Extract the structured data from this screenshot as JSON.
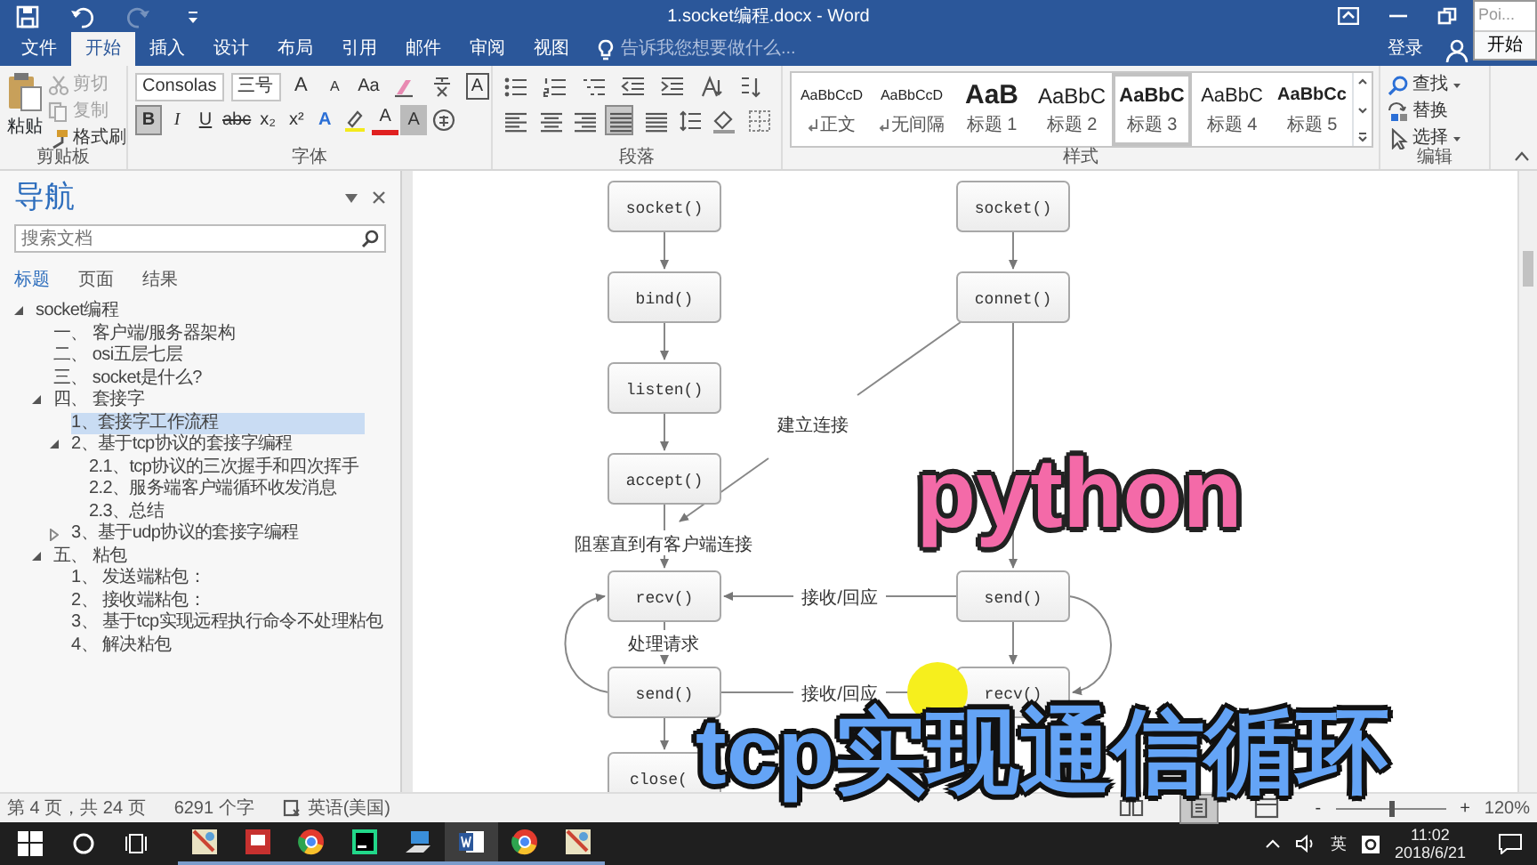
{
  "window": {
    "title": "1.socket编程.docx - Word"
  },
  "quick_access": [
    {
      "kind": "save",
      "disabled": false
    },
    {
      "kind": "undo",
      "disabled": false
    },
    {
      "kind": "redo",
      "disabled": true
    },
    {
      "kind": "customize",
      "disabled": false
    }
  ],
  "popup": {
    "title": "Poi...",
    "button": "开始"
  },
  "tabs": [
    {
      "label": "文件",
      "selected": false
    },
    {
      "label": "开始",
      "selected": true
    },
    {
      "label": "插入",
      "selected": false
    },
    {
      "label": "设计",
      "selected": false
    },
    {
      "label": "布局",
      "selected": false
    },
    {
      "label": "引用",
      "selected": false
    },
    {
      "label": "邮件",
      "selected": false
    },
    {
      "label": "审阅",
      "selected": false
    },
    {
      "label": "视图",
      "selected": false
    }
  ],
  "tell_me": {
    "placeholder": "告诉我您想要做什么..."
  },
  "sign_in": "登录",
  "clipboard": {
    "label": "剪贴板",
    "paste": "粘贴",
    "items": [
      {
        "kind": "cut",
        "label": "剪切",
        "disabled": true
      },
      {
        "kind": "copy",
        "label": "复制",
        "disabled": true
      },
      {
        "kind": "painter",
        "label": "格式刷",
        "disabled": false
      }
    ]
  },
  "font": {
    "label": "字体",
    "font_name": "Consolas",
    "font_size": "三号",
    "row1": [
      {
        "kind": "grow",
        "text": "A",
        "selected": false
      },
      {
        "kind": "shrink",
        "text": "A",
        "selected": false
      },
      {
        "kind": "case",
        "text": "Aa",
        "selected": false
      },
      {
        "kind": "clear",
        "selected": false
      },
      {
        "kind": "phonetic",
        "selected": false
      },
      {
        "kind": "border",
        "text": "A",
        "selected": false
      }
    ],
    "row2": [
      {
        "kind": "bold",
        "text": "B",
        "selected": true
      },
      {
        "kind": "italic",
        "text": "I",
        "selected": false
      },
      {
        "kind": "underline",
        "text": "U",
        "selected": false
      },
      {
        "kind": "strike",
        "text": "abc",
        "selected": false
      },
      {
        "kind": "sub",
        "text": "x₂",
        "selected": false
      },
      {
        "kind": "sup",
        "text": "x²",
        "selected": false
      },
      {
        "kind": "effect",
        "text": "A",
        "selected": false
      },
      {
        "kind": "highlight",
        "selected": false
      },
      {
        "kind": "color",
        "text": "A",
        "selected": false
      },
      {
        "kind": "shading",
        "text": "A",
        "selected": false
      },
      {
        "kind": "enclose",
        "selected": false
      }
    ]
  },
  "paragraph": {
    "label": "段落",
    "row1": [
      {
        "kind": "bullets",
        "selected": false
      },
      {
        "kind": "numbering",
        "selected": false
      },
      {
        "kind": "multilevel",
        "selected": false
      },
      {
        "kind": "outdent",
        "selected": false
      },
      {
        "kind": "indent",
        "selected": false
      },
      {
        "kind": "layout",
        "selected": false
      },
      {
        "kind": "sort",
        "selected": false
      }
    ],
    "row2": [
      {
        "kind": "left",
        "selected": false
      },
      {
        "kind": "center",
        "selected": false
      },
      {
        "kind": "right",
        "selected": false
      },
      {
        "kind": "justify",
        "selected": true
      },
      {
        "kind": "distribute",
        "selected": false
      },
      {
        "kind": "spacing",
        "selected": false
      },
      {
        "kind": "shading",
        "selected": false
      },
      {
        "kind": "borders",
        "selected": false
      }
    ]
  },
  "styles": {
    "label": "样式",
    "items": [
      {
        "kind": "normal",
        "preview": "AaBbCcD",
        "name": "正文",
        "paragraph_mark": true,
        "selected": false
      },
      {
        "kind": "normal",
        "preview": "AaBbCcD",
        "name": "无间隔",
        "paragraph_mark": true,
        "selected": false
      },
      {
        "kind": "h1",
        "preview": "AaB",
        "name": "标题 1",
        "paragraph_mark": false,
        "selected": false
      },
      {
        "kind": "h2",
        "preview": "AaBbC",
        "name": "标题 2",
        "paragraph_mark": false,
        "selected": false
      },
      {
        "kind": "h3",
        "preview": "AaBbC",
        "name": "标题 3",
        "paragraph_mark": false,
        "selected": true
      },
      {
        "kind": "h4",
        "preview": "AaBbC",
        "name": "标题 4",
        "paragraph_mark": false,
        "selected": false
      },
      {
        "kind": "h5",
        "preview": "AaBbCc",
        "name": "标题 5",
        "paragraph_mark": false,
        "selected": false
      }
    ]
  },
  "editing": {
    "label": "编辑",
    "items": [
      {
        "kind": "find",
        "label": "查找",
        "dropdown": true
      },
      {
        "kind": "replace",
        "label": "替换",
        "dropdown": false
      },
      {
        "kind": "select",
        "label": "选择",
        "dropdown": true
      }
    ]
  },
  "navigation": {
    "title": "导航",
    "search_placeholder": "搜索文档",
    "tabs": [
      {
        "label": "标题",
        "selected": true
      },
      {
        "label": "页面",
        "selected": false
      },
      {
        "label": "结果",
        "selected": false
      }
    ],
    "tree": [
      {
        "label": "socket编程",
        "expanded": true,
        "selected": false,
        "children": [
          {
            "label": "一、 客户端/服务器架构",
            "selected": false
          },
          {
            "label": "二、 osi五层七层",
            "selected": false
          },
          {
            "label": "三、 socket是什么?",
            "selected": false
          },
          {
            "label": "四、 套接字",
            "expanded": true,
            "selected": false,
            "children": [
              {
                "label": "1、套接字工作流程",
                "selected": true
              },
              {
                "label": "2、基于tcp协议的套接字编程",
                "expanded": true,
                "selected": false,
                "children": [
                  {
                    "label": "2.1、tcp协议的三次握手和四次挥手",
                    "selected": false
                  },
                  {
                    "label": "2.2、服务端客户端循环收发消息",
                    "selected": false
                  },
                  {
                    "label": "2.3、总结",
                    "selected": false
                  }
                ]
              },
              {
                "label": "3、基于udp协议的套接字编程",
                "expanded": false,
                "selected": false
              }
            ]
          },
          {
            "label": "五、 粘包",
            "expanded": true,
            "selected": false,
            "children": [
              {
                "label": "1、 发送端粘包：",
                "selected": false
              },
              {
                "label": "2、 接收端粘包：",
                "selected": false
              },
              {
                "label": "3、 基于tcp实现远程执行命令不处理粘包",
                "selected": false
              },
              {
                "label": "4、 解决粘包",
                "selected": false
              }
            ]
          }
        ]
      }
    ]
  },
  "diagram": {
    "nodes": [
      {
        "text": "socket()"
      },
      {
        "text": "bind()"
      },
      {
        "text": "listen()"
      },
      {
        "text": "accept()"
      },
      {
        "text": "recv()"
      },
      {
        "text": "send()"
      },
      {
        "text": "close("
      },
      {
        "text": "socket()"
      },
      {
        "text": "connet()"
      },
      {
        "text": "send()"
      },
      {
        "text": "recv()"
      }
    ],
    "labels": [
      "建立连接",
      "阻塞直到有客户端连接",
      "接收/回应",
      "处理请求",
      "接收/回应"
    ]
  },
  "captions": [
    {
      "text": "python",
      "kind": "pink"
    },
    {
      "text": "tcp实现通信循环",
      "kind": "blue"
    }
  ],
  "status_bar": {
    "page": "第 4 页，共 24 页",
    "words": "6291 个字",
    "language": "英语(美国)",
    "views": [
      {
        "kind": "read",
        "selected": false
      },
      {
        "kind": "print",
        "selected": true
      },
      {
        "kind": "web",
        "selected": false
      }
    ],
    "zoom": {
      "minus": "-",
      "plus": "+",
      "level": 0.5,
      "percent": "120%"
    }
  },
  "taskbar": {
    "apps": [
      {
        "kind": "picture",
        "selected": false
      },
      {
        "kind": "slides",
        "selected": false
      },
      {
        "kind": "browser",
        "selected": false
      },
      {
        "kind": "ide",
        "selected": false
      },
      {
        "kind": "network",
        "selected": false
      },
      {
        "kind": "word",
        "selected": true
      },
      {
        "kind": "browser",
        "selected": false
      },
      {
        "kind": "picture",
        "selected": false
      }
    ],
    "input_method": "英",
    "time": "11:02",
    "date": "2018/6/21"
  }
}
